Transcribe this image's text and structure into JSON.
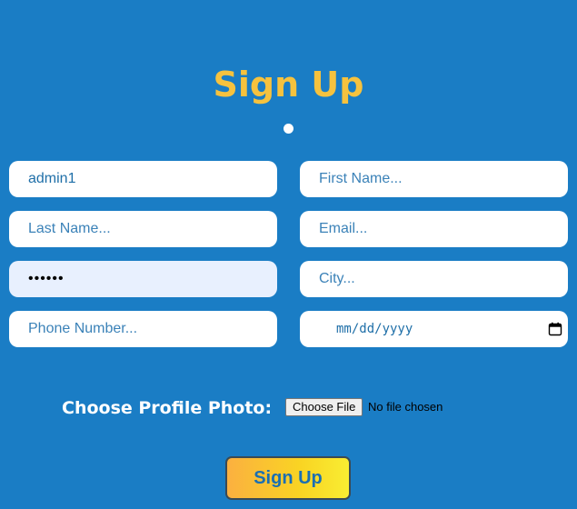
{
  "heading": "Sign Up",
  "form": {
    "username": {
      "value": "admin1",
      "placeholder": ""
    },
    "first_name": {
      "placeholder": "First Name..."
    },
    "last_name": {
      "placeholder": "Last Name..."
    },
    "email": {
      "placeholder": "Email..."
    },
    "password": {
      "masked_value": "••••••"
    },
    "city": {
      "placeholder": "City..."
    },
    "phone": {
      "placeholder": "Phone Number..."
    },
    "birth_date": {
      "placeholder": "mm/dd/yyyy",
      "icon": "calendar-icon"
    }
  },
  "photo": {
    "label": "Choose Profile Photo:",
    "button_label": "Choose File",
    "status": "No file chosen"
  },
  "submit": {
    "label": "Sign Up"
  },
  "colors": {
    "background": "#1a7dc5",
    "heading": "#f6c23e",
    "button_gradient_start": "#fbb040",
    "button_gradient_end": "#f9ed32"
  }
}
